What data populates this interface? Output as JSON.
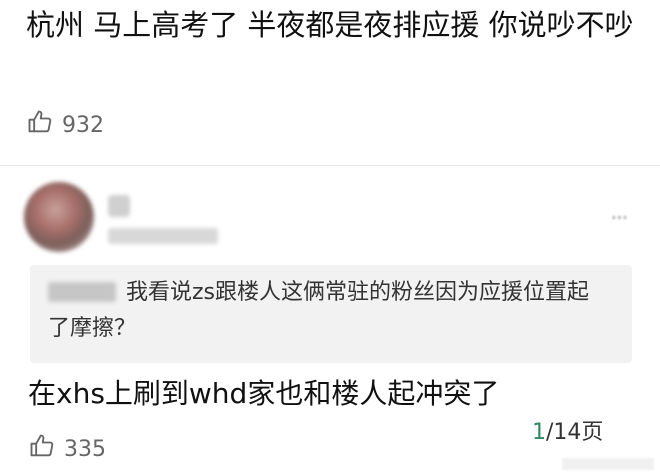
{
  "comment": {
    "text": "杭州 马上高考了 半夜都是夜排应援 你说吵不吵",
    "likes": "932"
  },
  "reply": {
    "quote_text": "我看说zs跟楼人这俩常驻的粉丝因为应援位置起了摩擦？",
    "text": "在xhs上刷到whd家也和楼人起冲突了",
    "likes": "335"
  },
  "pagination": {
    "current": "1",
    "total": "/14页"
  },
  "icons": {
    "like": "thumbs-up-icon",
    "more": "more-dots-icon"
  },
  "colors": {
    "page_current": "#2d8a5f",
    "quote_bg": "#f2f2f2"
  }
}
